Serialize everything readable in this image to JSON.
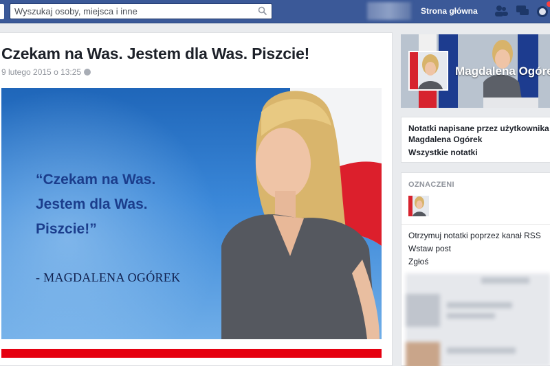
{
  "topbar": {
    "search_placeholder": "Wyszukaj osoby, miejsca i inne",
    "home_label": "Strona główna",
    "icons": [
      "facebook-logo-icon",
      "search-icon",
      "friends-icon",
      "messages-icon",
      "notifications-globe-icon"
    ]
  },
  "post": {
    "title": "Czekam na Was. Jestem dla Was. Piszcie!",
    "date": "9 lutego 2015 o 13:25",
    "image": {
      "quote_line1": "“Czekam na Was.",
      "quote_line2": "Jestem dla Was.",
      "quote_line3": "Piszcie!”",
      "signature": "- MAGDALENA OGÓREK"
    }
  },
  "sidebar": {
    "profile_name": "Magdalena Ogórek",
    "notes_title": "Notatki napisane przez użytkownika Magdalena Ogórek",
    "all_notes": "Wszystkie notatki",
    "tagged_label": "OZNACZENI",
    "links": [
      "Otrzymuj notatki poprzez kanał RSS",
      "Wstaw post",
      "Zgłoś"
    ]
  },
  "colors": {
    "topbar": "#3b5998",
    "quote_text": "#1b3d8c",
    "accent_red": "#e50010"
  }
}
